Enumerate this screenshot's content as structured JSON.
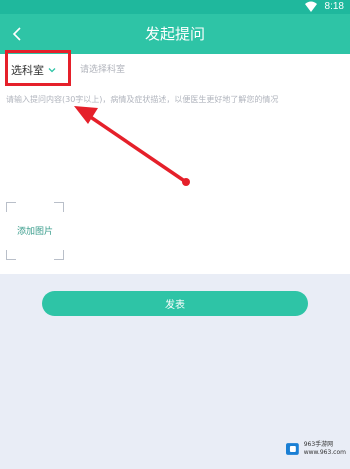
{
  "status_bar": {
    "time": "8:18"
  },
  "app_bar": {
    "title": "发起提问"
  },
  "form": {
    "subject_selector": {
      "value": "选科室"
    },
    "subject_hint": "请选择科室",
    "question_input": {
      "placeholder": "请输入提问内容(30字以上)，病情及症状描述，以便医生更好地了解您的情况"
    },
    "add_image": {
      "label": "添加图片"
    },
    "submit_label": "发表"
  },
  "watermark": {
    "brand": "963手游网",
    "sub": "www.963.com"
  },
  "colors": {
    "accent": "#2ec4a6",
    "status_bar": "#1fb89d",
    "highlight": "#e5202a",
    "background": "#e9edf6"
  }
}
